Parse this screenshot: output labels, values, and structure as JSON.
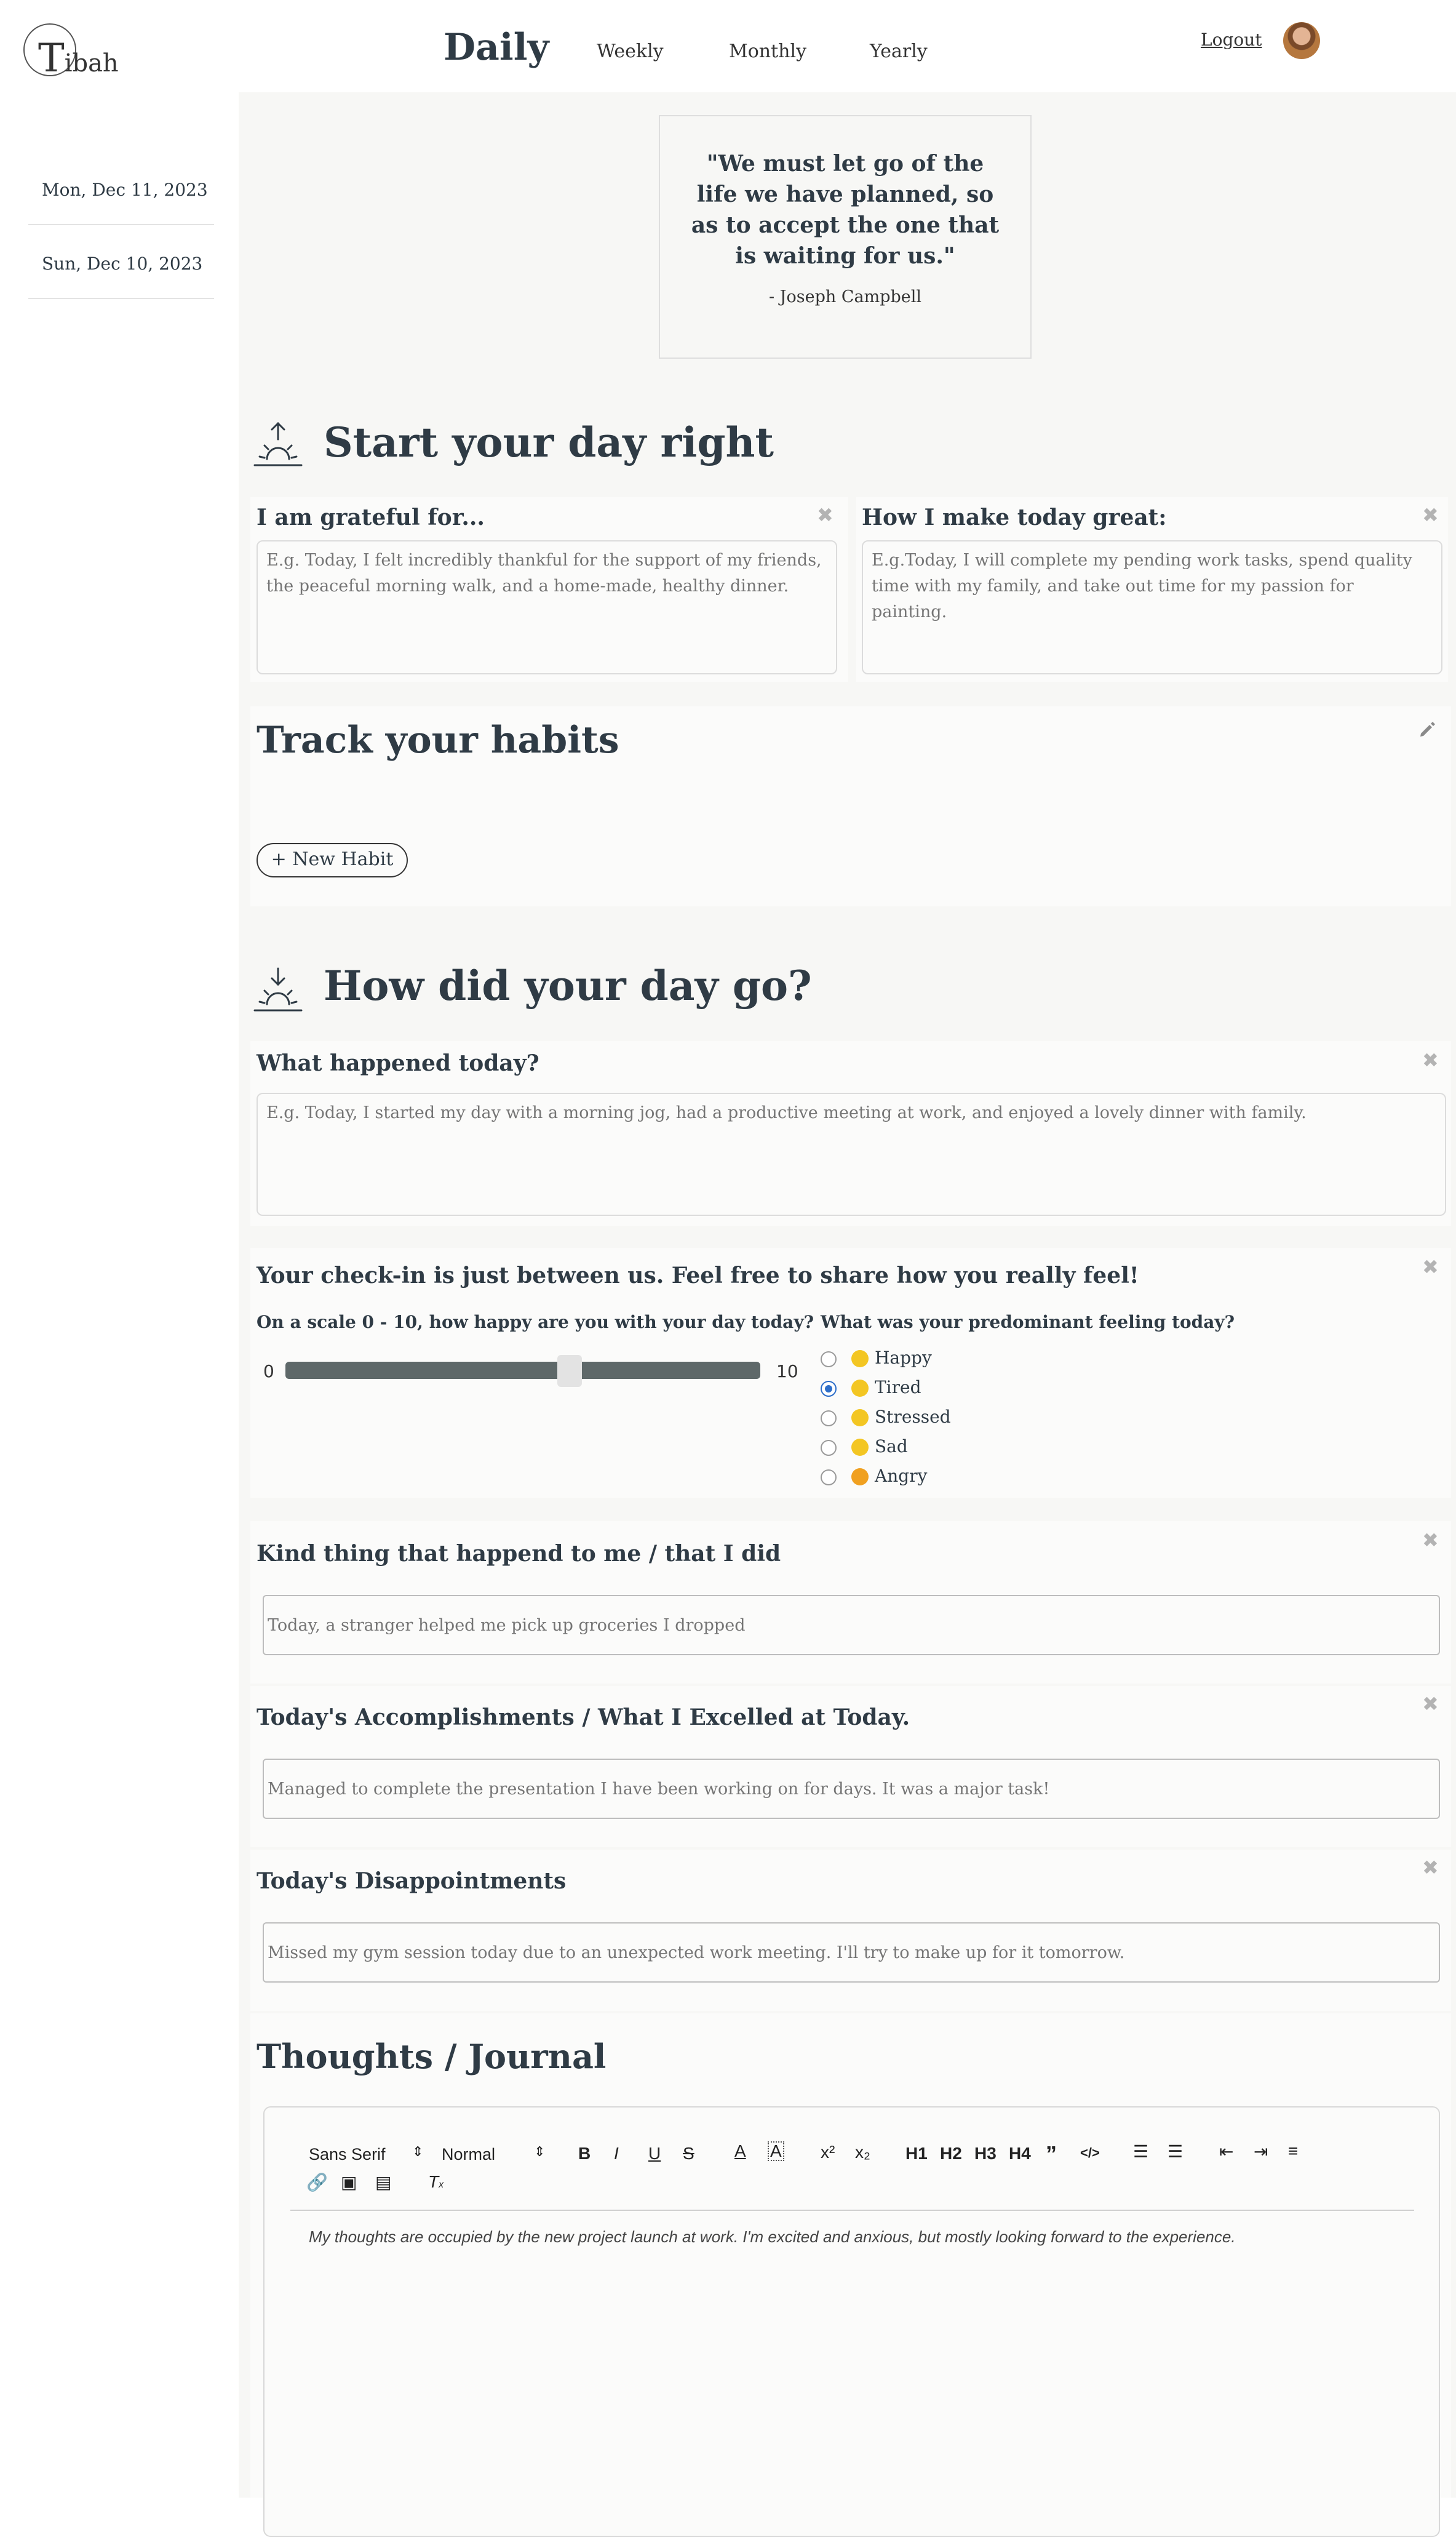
{
  "app": {
    "logo_big": "T",
    "logo_small": "ibah"
  },
  "nav": {
    "daily": "Daily",
    "weekly": "Weekly",
    "monthly": "Monthly",
    "yearly": "Yearly",
    "logout": "Logout"
  },
  "sidebar": {
    "items": [
      {
        "label": "Mon, Dec 11, 2023"
      },
      {
        "label": "Sun, Dec 10, 2023"
      }
    ]
  },
  "quote": {
    "text": "\"We must let go of the life we have planned, so as to accept the one that is waiting for us.\"",
    "author": "- Joseph Campbell"
  },
  "start_section": {
    "title": "Start your day right",
    "grateful": {
      "title": "I am grateful for...",
      "placeholder": "E.g. Today, I felt incredibly thankful for the support of my friends, the peaceful morning walk, and a home-made, healthy dinner."
    },
    "great": {
      "title": "How I make today great:",
      "placeholder": "E.g.Today, I will complete my pending work tasks, spend quality time with my family, and take out time for my passion for painting."
    }
  },
  "habits": {
    "title": "Track your habits",
    "new_habit": "+ New Habit"
  },
  "day_section": {
    "title": "How did your day go?",
    "happened": {
      "title": "What happened today?",
      "placeholder": "E.g. Today, I started my day with a morning jog, had a productive meeting at work, and enjoyed a lovely dinner with family."
    },
    "checkin": {
      "title": "Your check-in is just between us. Feel free to share how you really feel!",
      "scale_label": "On a scale 0 - 10, how happy are you with your day today?",
      "min": "0",
      "max": "10",
      "value": 6,
      "feeling_label": "What was your predominant feeling today?",
      "feelings": [
        {
          "label": "Happy",
          "checked": false,
          "icon": "smile-emoji-icon"
        },
        {
          "label": "Tired",
          "checked": true,
          "icon": "tired-emoji-icon"
        },
        {
          "label": "Stressed",
          "checked": false,
          "icon": "stressed-emoji-icon"
        },
        {
          "label": "Sad",
          "checked": false,
          "icon": "sad-emoji-icon"
        },
        {
          "label": "Angry",
          "checked": false,
          "icon": "angry-emoji-icon"
        }
      ]
    },
    "kind": {
      "title": "Kind thing that happend to me / that I did",
      "placeholder": "Today, a stranger helped me pick up groceries I dropped"
    },
    "accomplishments": {
      "title": "Today's Accomplishments / What I Excelled at Today.",
      "placeholder": "Managed to complete the presentation I have been working on for days. It was a major task!"
    },
    "disappointments": {
      "title": "Today's Disappointments",
      "placeholder": "Missed my gym session today due to an unexpected work meeting. I'll try to make up for it tomorrow."
    }
  },
  "journal": {
    "title": "Thoughts / Journal",
    "font": "Sans Serif",
    "size": "Normal",
    "placeholder": "My thoughts are occupied by the new project launch at work. I'm excited and anxious, but mostly looking forward to the experience.",
    "toolbar": {
      "bold": "B",
      "italic": "I",
      "underline": "U",
      "strike": "S",
      "h1": "H1",
      "h2": "H2",
      "h3": "H3",
      "h4": "H4",
      "quote": "”",
      "code": "</>"
    }
  }
}
